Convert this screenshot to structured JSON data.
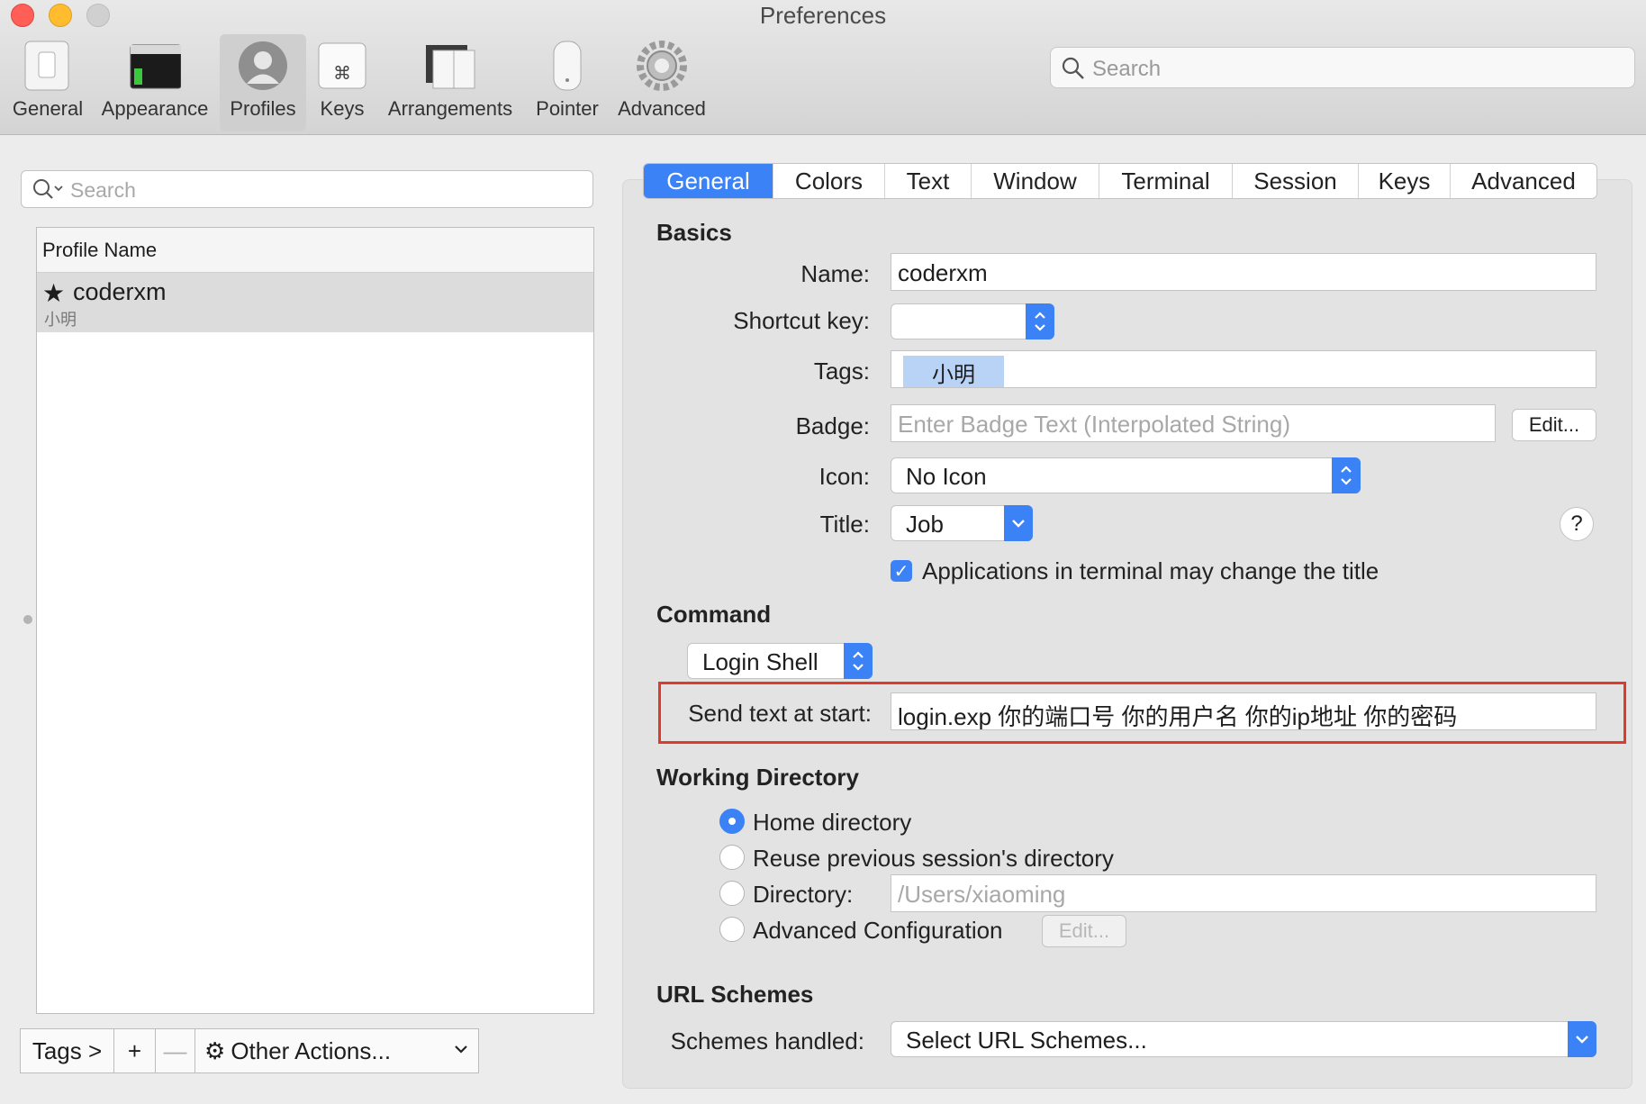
{
  "window": {
    "title": "Preferences"
  },
  "toolbar": {
    "items": [
      {
        "label": "General"
      },
      {
        "label": "Appearance"
      },
      {
        "label": "Profiles"
      },
      {
        "label": "Keys"
      },
      {
        "label": "Arrangements"
      },
      {
        "label": "Pointer"
      },
      {
        "label": "Advanced"
      }
    ],
    "selected": "Profiles",
    "search_placeholder": "Search"
  },
  "profiles": {
    "search_placeholder": "Search",
    "column_header": "Profile Name",
    "rows": [
      {
        "name": "coderxm",
        "tag": "小明",
        "default": true
      }
    ]
  },
  "bottom_bar": {
    "tags": "Tags >",
    "add": "+",
    "remove": "—",
    "other_actions": "Other Actions..."
  },
  "tabs": [
    "General",
    "Colors",
    "Text",
    "Window",
    "Terminal",
    "Session",
    "Keys",
    "Advanced"
  ],
  "selected_tab": "General",
  "basics": {
    "heading": "Basics",
    "name_label": "Name:",
    "name_value": "coderxm",
    "shortcut_label": "Shortcut key:",
    "shortcut_value": "",
    "tags_label": "Tags:",
    "tags": [
      "小明"
    ],
    "badge_label": "Badge:",
    "badge_placeholder": "Enter Badge Text (Interpolated String)",
    "badge_edit": "Edit...",
    "icon_label": "Icon:",
    "icon_value": "No Icon",
    "title_label": "Title:",
    "title_value": "Job",
    "help": "?",
    "apps_change_title": "Applications in terminal may change the title",
    "apps_change_title_checked": true
  },
  "command": {
    "heading": "Command",
    "shell": "Login Shell",
    "send_text_label": "Send text at start:",
    "send_text_value": "login.exp 你的端口号 你的用户名 你的ip地址 你的密码"
  },
  "working_directory": {
    "heading": "Working Directory",
    "options": [
      "Home directory",
      "Reuse previous session's directory",
      "Directory:",
      "Advanced Configuration"
    ],
    "selected": "Home directory",
    "directory_placeholder": "/Users/xiaoming",
    "advanced_edit": "Edit..."
  },
  "url_schemes": {
    "heading": "URL Schemes",
    "label": "Schemes handled:",
    "value": "Select URL Schemes..."
  },
  "colors": {
    "accent": "#3a82f6",
    "highlight_box": "#e03a2a",
    "tag_chip": "#b9d3f7"
  }
}
